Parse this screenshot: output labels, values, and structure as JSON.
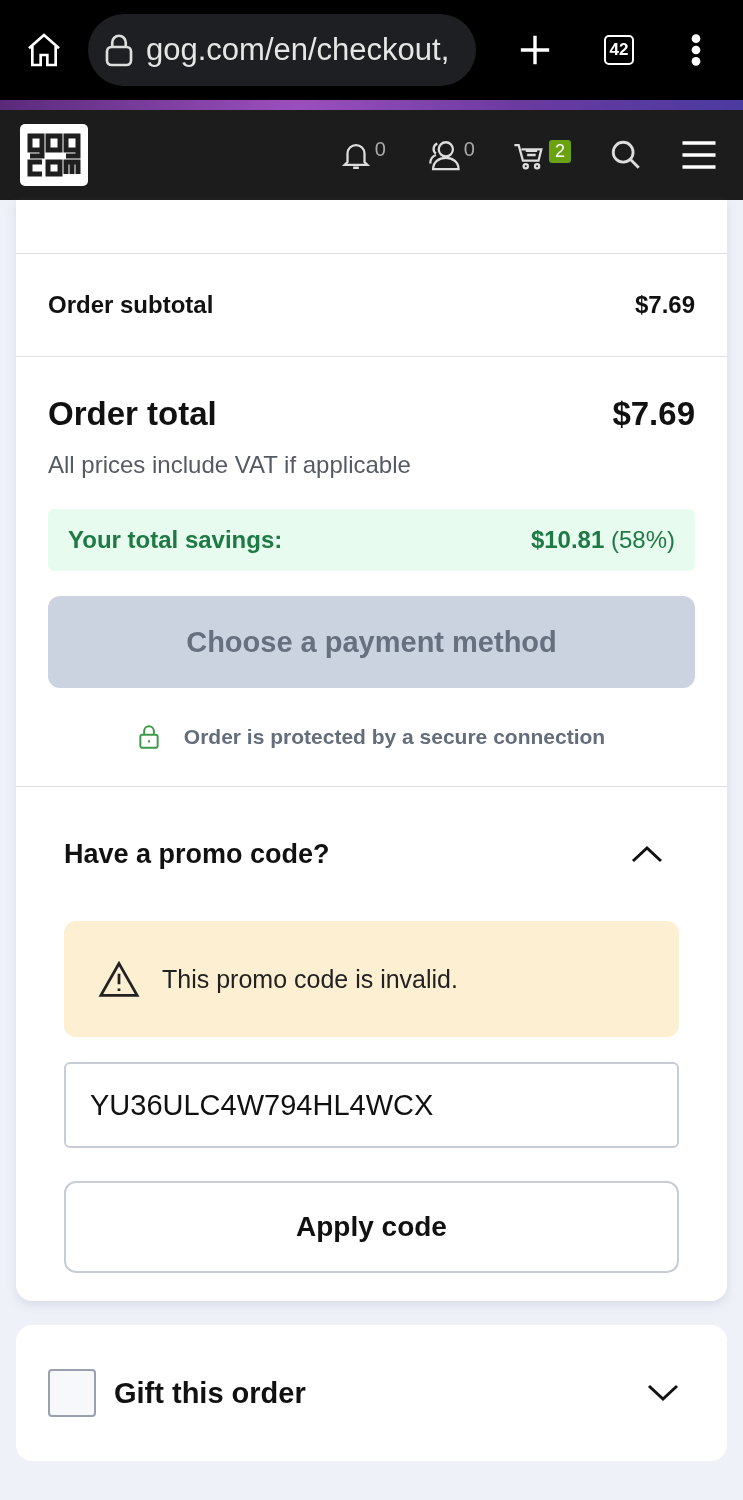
{
  "browser": {
    "url": "gog.com/en/checkout,",
    "tab_count": "42"
  },
  "header": {
    "notifications": "0",
    "friends": "0",
    "cart_count": "2"
  },
  "summary": {
    "subtotal_label": "Order subtotal",
    "subtotal": "$7.69",
    "total_label": "Order total",
    "total": "$7.69",
    "vat_note": "All prices include VAT if applicable",
    "savings_label": "Your total savings:",
    "savings_amount": "$10.81",
    "savings_percent": "(58%)",
    "pay_button": {
      "label": "Choose a payment method",
      "disabled": true
    },
    "secure_note": "Order is protected by a secure connection"
  },
  "promo": {
    "title": "Have a promo code?",
    "expanded": true,
    "warning": "This promo code is invalid.",
    "code": "YU36ULC4W794HL4WCX",
    "apply_button": "Apply code"
  },
  "gift": {
    "label": "Gift this order",
    "checked": false,
    "expanded": false
  }
}
